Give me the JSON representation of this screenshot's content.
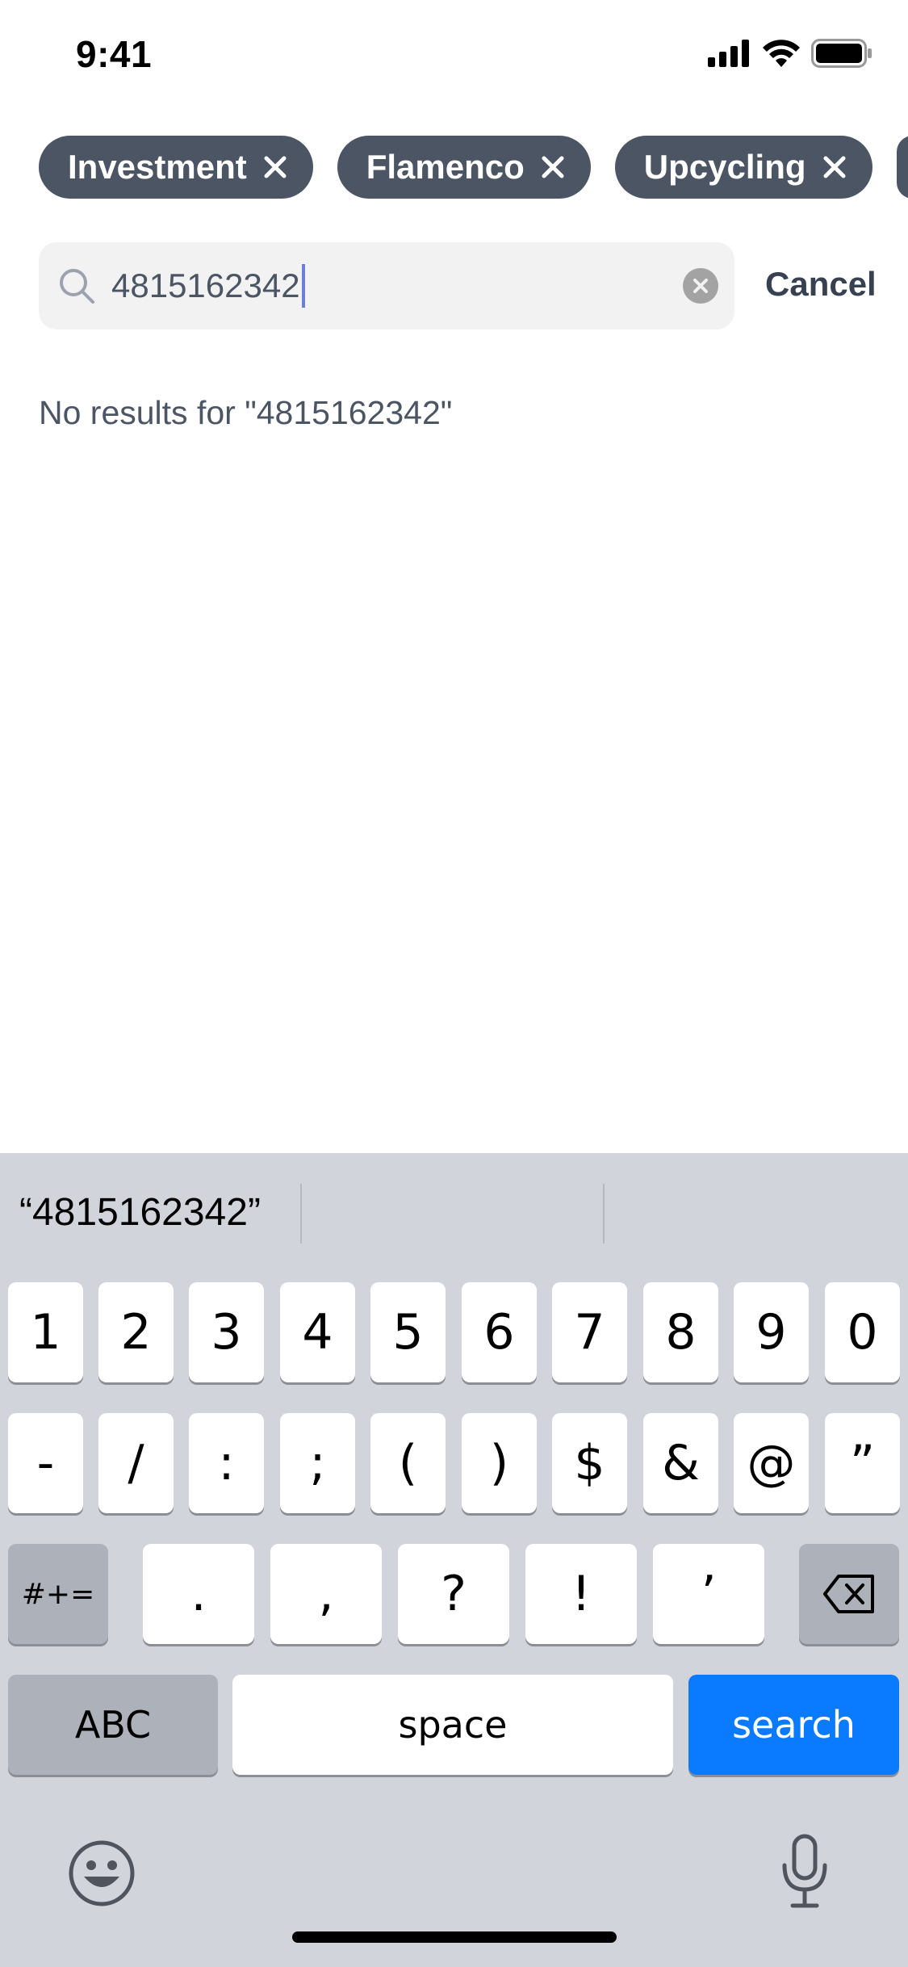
{
  "status": {
    "time": "9:41"
  },
  "chips": [
    {
      "label": "Investment"
    },
    {
      "label": "Flamenco"
    },
    {
      "label": "Upcycling"
    }
  ],
  "search": {
    "value": "4815162342",
    "cancel_label": "Cancel"
  },
  "results": {
    "empty_message": "No results for \"4815162342\""
  },
  "keyboard": {
    "suggestion": "“4815162342”",
    "row1": [
      "1",
      "2",
      "3",
      "4",
      "5",
      "6",
      "7",
      "8",
      "9",
      "0"
    ],
    "row2": [
      "-",
      "/",
      ":",
      ";",
      "(",
      ")",
      "$",
      "&",
      "@",
      "”"
    ],
    "row3_mode": "#+=",
    "row3": [
      ".",
      ",",
      "?",
      "!",
      "’"
    ],
    "abc_label": "ABC",
    "space_label": "space",
    "search_label": "search"
  },
  "colors": {
    "chip_bg": "#4b5563",
    "keyboard_bg": "#d1d4db",
    "search_key": "#0a7aff"
  }
}
